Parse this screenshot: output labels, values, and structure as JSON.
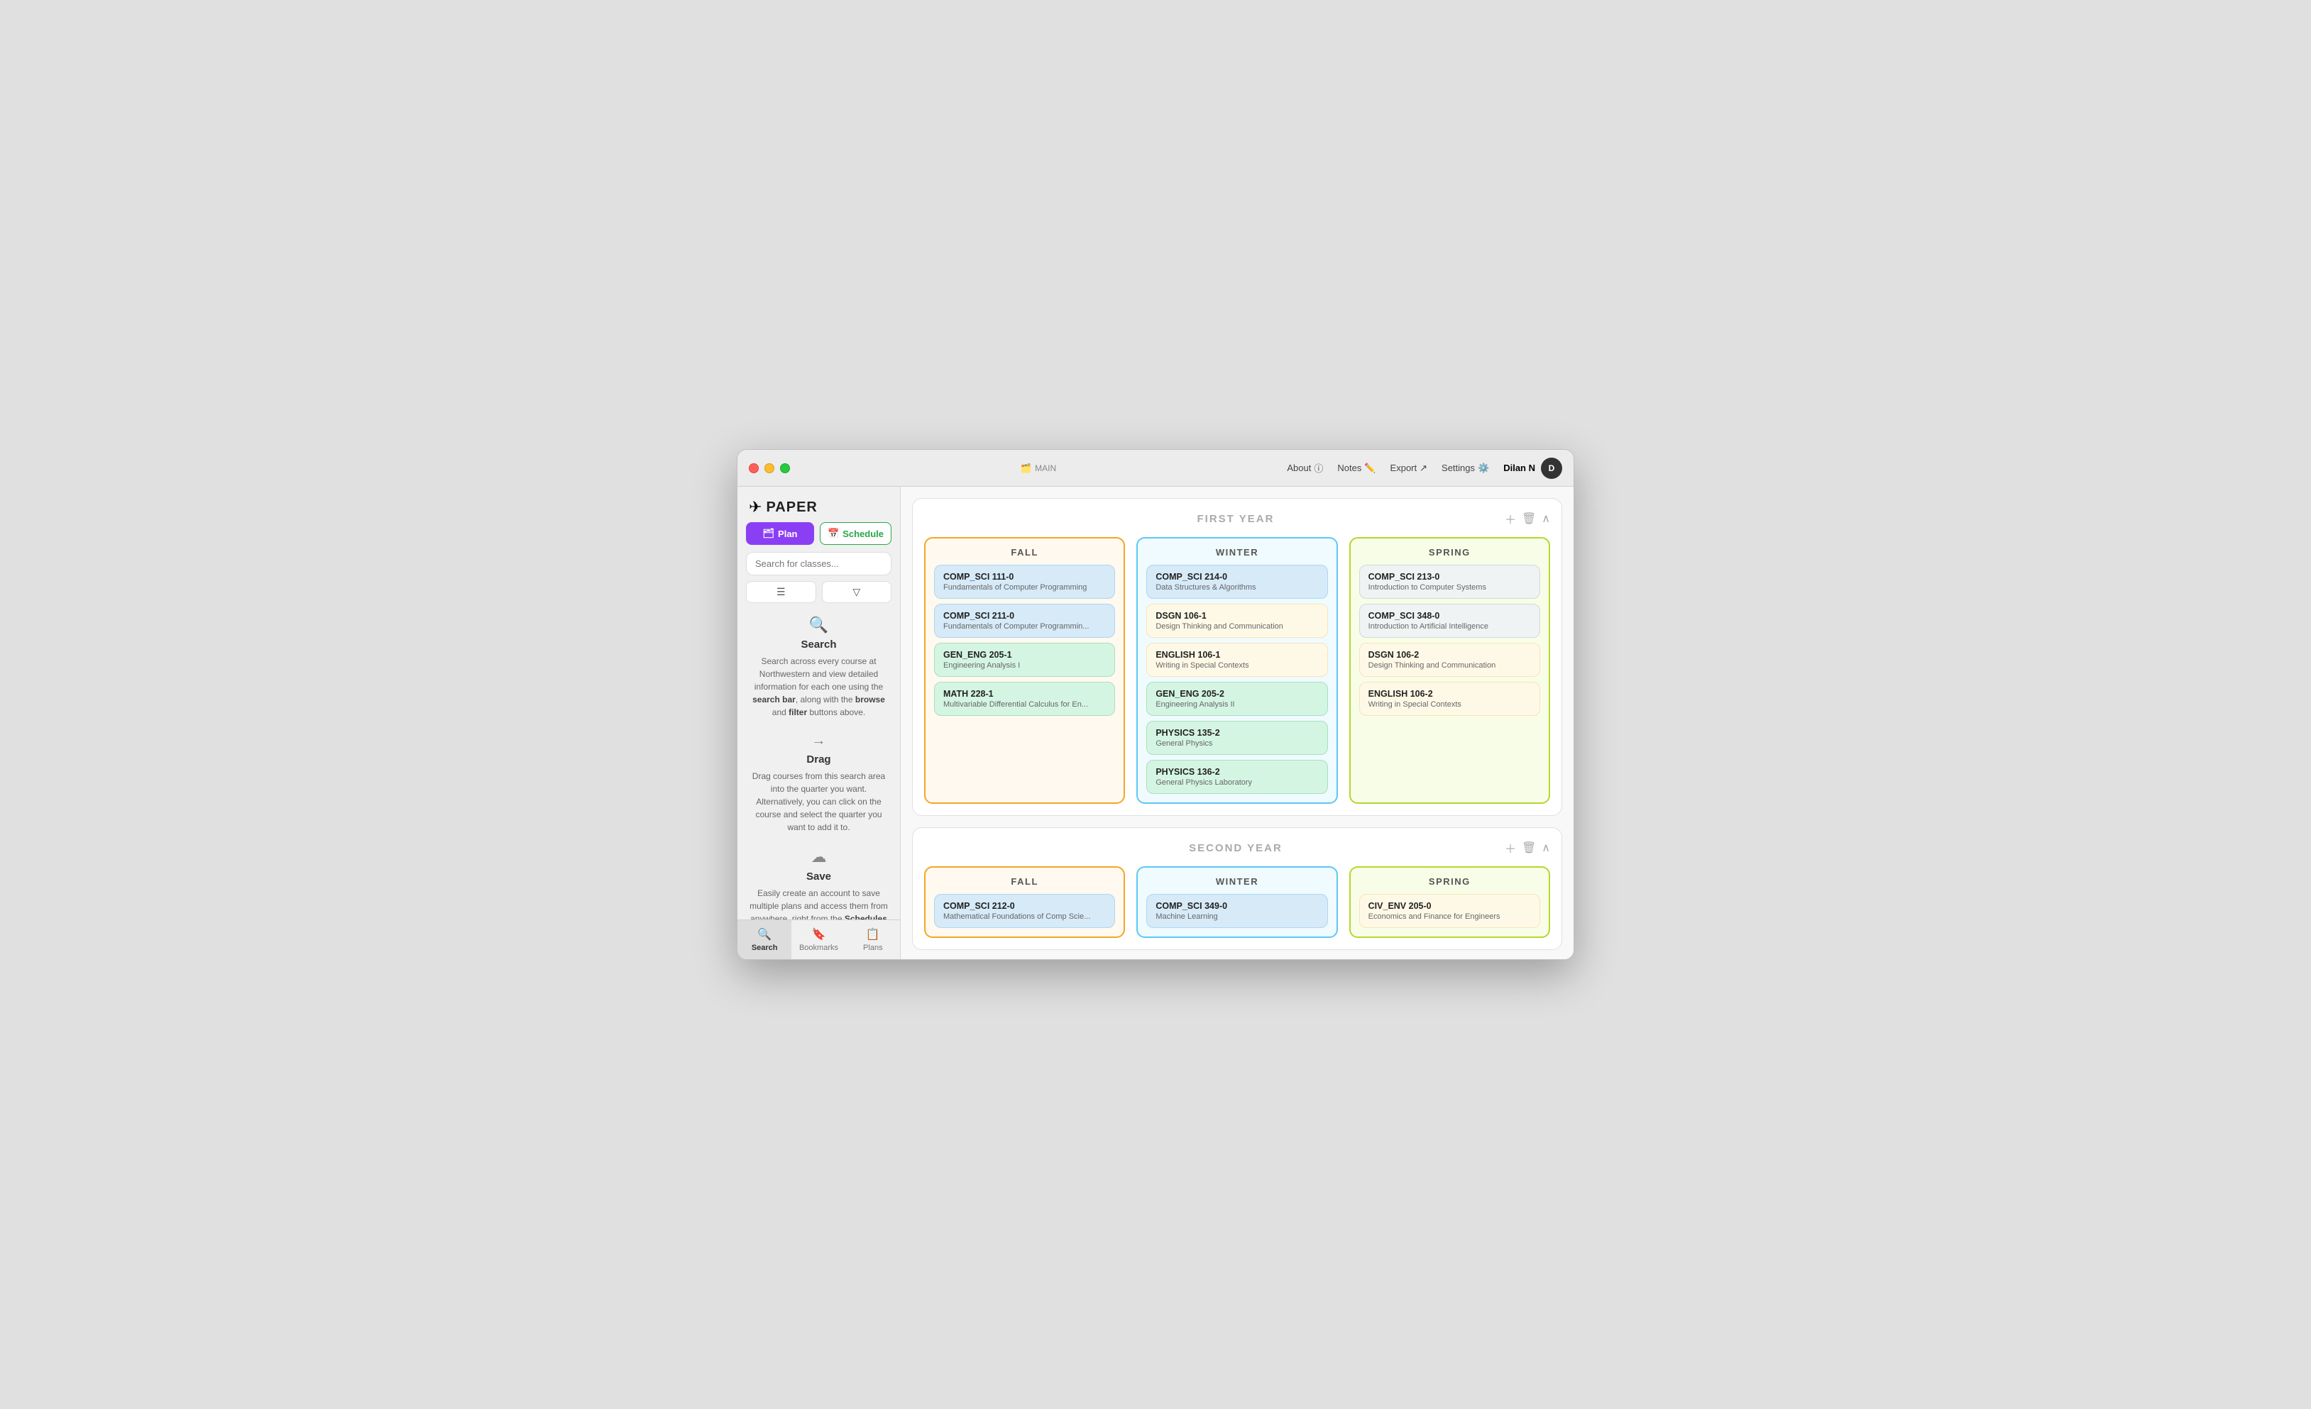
{
  "window": {
    "title": "Paper"
  },
  "titlebar": {
    "main_label": "MAIN",
    "about_label": "About",
    "notes_label": "Notes",
    "export_label": "Export",
    "settings_label": "Settings",
    "user_name": "Dilan N",
    "user_initial": "D"
  },
  "sidebar": {
    "logo_text": "PAPER",
    "plan_label": "Plan",
    "schedule_label": "Schedule",
    "search_placeholder": "Search for classes...",
    "browse_label": "Browse",
    "filter_label": "Filter",
    "info_sections": [
      {
        "id": "search",
        "icon": "🔍",
        "title": "Search",
        "desc": "Search across every course at Northwestern and view detailed information for each one using the search bar, along with the browse and filter buttons above."
      },
      {
        "id": "drag",
        "icon": "→",
        "title": "Drag",
        "desc": "Drag courses from this search area into the quarter you want. Alternatively, you can click on the course and select the quarter you want to add it to."
      },
      {
        "id": "save",
        "icon": "☁",
        "title": "Save",
        "desc": "Easily create an account to save multiple plans and access them from anywhere, right from the Schedules tab at the bottom."
      }
    ],
    "bottom_nav": [
      {
        "id": "search",
        "label": "Search",
        "icon": "🔍",
        "active": true
      },
      {
        "id": "bookmarks",
        "label": "Bookmarks",
        "icon": "🔖",
        "active": false
      },
      {
        "id": "plans",
        "label": "Plans",
        "icon": "📋",
        "active": false
      }
    ]
  },
  "years": [
    {
      "id": "first-year",
      "title": "FIRST YEAR",
      "quarters": [
        {
          "id": "fall-1",
          "season": "FALL",
          "type": "fall",
          "courses": [
            {
              "id": "cs111",
              "name": "COMP_SCI 111-0",
              "desc": "Fundamentals of Computer Programming",
              "color": "blue"
            },
            {
              "id": "cs211",
              "name": "COMP_SCI 211-0",
              "desc": "Fundamentals of Computer Programmin...",
              "color": "blue"
            },
            {
              "id": "gen205",
              "name": "GEN_ENG 205-1",
              "desc": "Engineering Analysis I",
              "color": "teal"
            },
            {
              "id": "math228",
              "name": "MATH 228-1",
              "desc": "Multivariable Differential Calculus for En...",
              "color": "teal"
            }
          ]
        },
        {
          "id": "winter-1",
          "season": "WINTER",
          "type": "winter",
          "courses": [
            {
              "id": "cs214",
              "name": "COMP_SCI 214-0",
              "desc": "Data Structures & Algorithms",
              "color": "blue"
            },
            {
              "id": "dsgn106-1",
              "name": "DSGN 106-1",
              "desc": "Design Thinking and Communication",
              "color": "tan"
            },
            {
              "id": "eng106-1",
              "name": "ENGLISH 106-1",
              "desc": "Writing in Special Contexts",
              "color": "tan"
            },
            {
              "id": "gen205-2",
              "name": "GEN_ENG 205-2",
              "desc": "Engineering Analysis II",
              "color": "teal"
            },
            {
              "id": "phys135",
              "name": "PHYSICS 135-2",
              "desc": "General Physics",
              "color": "teal"
            },
            {
              "id": "phys136",
              "name": "PHYSICS 136-2",
              "desc": "General Physics Laboratory",
              "color": "teal"
            }
          ]
        },
        {
          "id": "spring-1",
          "season": "SPRING",
          "type": "spring",
          "courses": [
            {
              "id": "cs213",
              "name": "COMP_SCI 213-0",
              "desc": "Introduction to Computer Systems",
              "color": "light"
            },
            {
              "id": "cs348",
              "name": "COMP_SCI 348-0",
              "desc": "Introduction to Artificial Intelligence",
              "color": "light"
            },
            {
              "id": "dsgn106-2",
              "name": "DSGN 106-2",
              "desc": "Design Thinking and Communication",
              "color": "tan"
            },
            {
              "id": "eng106-2",
              "name": "ENGLISH 106-2",
              "desc": "Writing in Special Contexts",
              "color": "tan"
            }
          ]
        }
      ]
    },
    {
      "id": "second-year",
      "title": "SECOND YEAR",
      "quarters": [
        {
          "id": "fall-2",
          "season": "FALL",
          "type": "fall",
          "courses": [
            {
              "id": "cs212",
              "name": "COMP_SCI 212-0",
              "desc": "Mathematical Foundations of Comp Scie...",
              "color": "blue"
            }
          ]
        },
        {
          "id": "winter-2",
          "season": "WINTER",
          "type": "winter",
          "courses": [
            {
              "id": "cs349",
              "name": "COMP_SCI 349-0",
              "desc": "Machine Learning",
              "color": "blue"
            }
          ]
        },
        {
          "id": "spring-2",
          "season": "SPRING",
          "type": "spring",
          "courses": [
            {
              "id": "civenv205",
              "name": "CIV_ENV 205-0",
              "desc": "Economics and Finance for Engineers",
              "color": "tan"
            }
          ]
        }
      ]
    }
  ]
}
